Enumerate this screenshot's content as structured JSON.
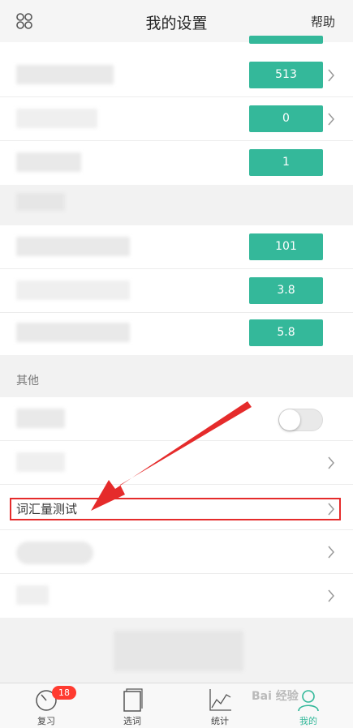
{
  "header": {
    "title": "我的设置",
    "help_label": "帮助"
  },
  "group1": {
    "rows": [
      {
        "value": "513"
      },
      {
        "value": "0"
      },
      {
        "value": "1"
      }
    ]
  },
  "group2": {
    "rows": [
      {
        "value": "101"
      },
      {
        "value": "3.8"
      },
      {
        "value": "5.8"
      }
    ]
  },
  "other": {
    "section_label": "其他",
    "vocab_test_label": "词汇量测试"
  },
  "tabbar": {
    "tabs": [
      {
        "label": "复习",
        "badge": "18"
      },
      {
        "label": "选词"
      },
      {
        "label": "统计"
      },
      {
        "label": "我的"
      }
    ]
  },
  "watermark": "Bai 经验",
  "colors": {
    "accent": "#34b89a",
    "badge": "#ff3b30",
    "highlight": "#e52b2b"
  }
}
